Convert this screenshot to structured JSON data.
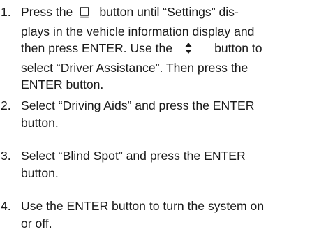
{
  "steps": [
    {
      "number": "1.",
      "lines": [
        {
          "before": "Press the",
          "icon": "display-mode-icon",
          "after": "button until “Settings” dis-"
        },
        {
          "text": "plays in the vehicle information display and"
        },
        {
          "before": "then press ENTER. Use the",
          "icon": "up-down-arrow-icon",
          "after": "button to"
        },
        {
          "text": "select “Driver Assistance”. Then press the"
        },
        {
          "text": "ENTER button."
        }
      ]
    },
    {
      "number": "2.",
      "lines": [
        {
          "text": "Select “Driving Aids” and press the ENTER"
        },
        {
          "text": "button."
        }
      ]
    },
    {
      "number": "3.",
      "lines": [
        {
          "text": "Select “Blind Spot” and press the ENTER"
        },
        {
          "text": "button."
        }
      ]
    },
    {
      "number": "4.",
      "lines": [
        {
          "text": "Use the ENTER button to turn the system on"
        },
        {
          "text": "or off."
        }
      ]
    }
  ]
}
